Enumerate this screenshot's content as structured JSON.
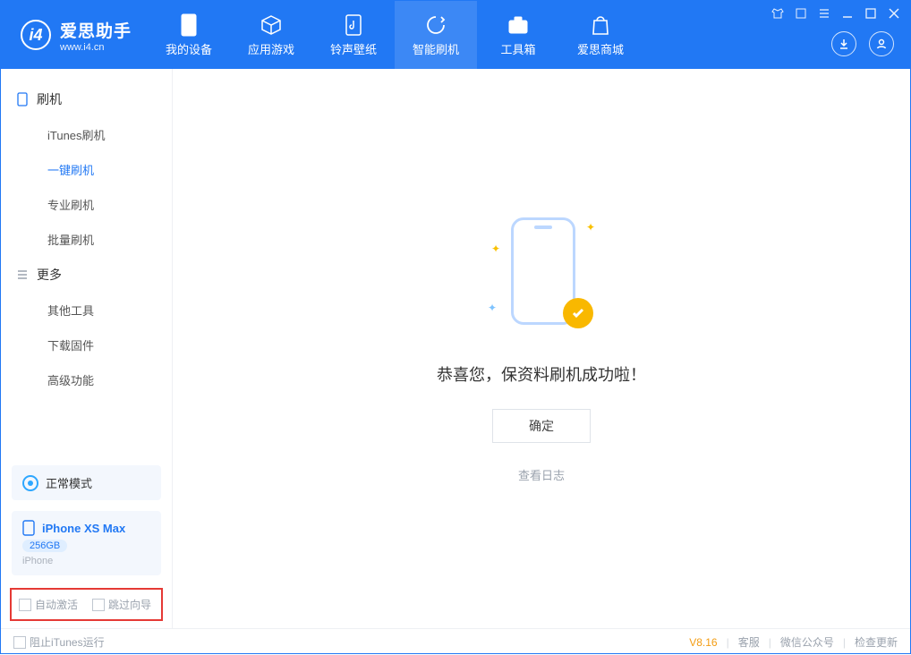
{
  "app": {
    "name_cn": "爱思助手",
    "name_en": "www.i4.cn"
  },
  "nav": {
    "tabs": [
      {
        "id": "device",
        "label": "我的设备"
      },
      {
        "id": "apps",
        "label": "应用游戏"
      },
      {
        "id": "ring",
        "label": "铃声壁纸"
      },
      {
        "id": "flash",
        "label": "智能刷机"
      },
      {
        "id": "toolbox",
        "label": "工具箱"
      },
      {
        "id": "store",
        "label": "爱思商城"
      }
    ],
    "active": "flash"
  },
  "sidebar": {
    "groups": [
      {
        "title": "刷机",
        "items": [
          {
            "id": "itunes",
            "label": "iTunes刷机"
          },
          {
            "id": "oneclick",
            "label": "一键刷机",
            "active": true
          },
          {
            "id": "pro",
            "label": "专业刷机"
          },
          {
            "id": "batch",
            "label": "批量刷机"
          }
        ]
      },
      {
        "title": "更多",
        "items": [
          {
            "id": "other",
            "label": "其他工具"
          },
          {
            "id": "firmware",
            "label": "下载固件"
          },
          {
            "id": "advanced",
            "label": "高级功能"
          }
        ]
      }
    ],
    "mode_label": "正常模式",
    "device": {
      "name": "iPhone XS Max",
      "capacity": "256GB",
      "type": "iPhone"
    },
    "options": {
      "auto_activate": "自动激活",
      "skip_guide": "跳过向导"
    }
  },
  "main": {
    "success_text": "恭喜您，保资料刷机成功啦！",
    "ok_label": "确定",
    "log_link": "查看日志"
  },
  "footer": {
    "block_itunes": "阻止iTunes运行",
    "version": "V8.16",
    "links": {
      "service": "客服",
      "wechat": "微信公众号",
      "update": "检查更新"
    }
  }
}
